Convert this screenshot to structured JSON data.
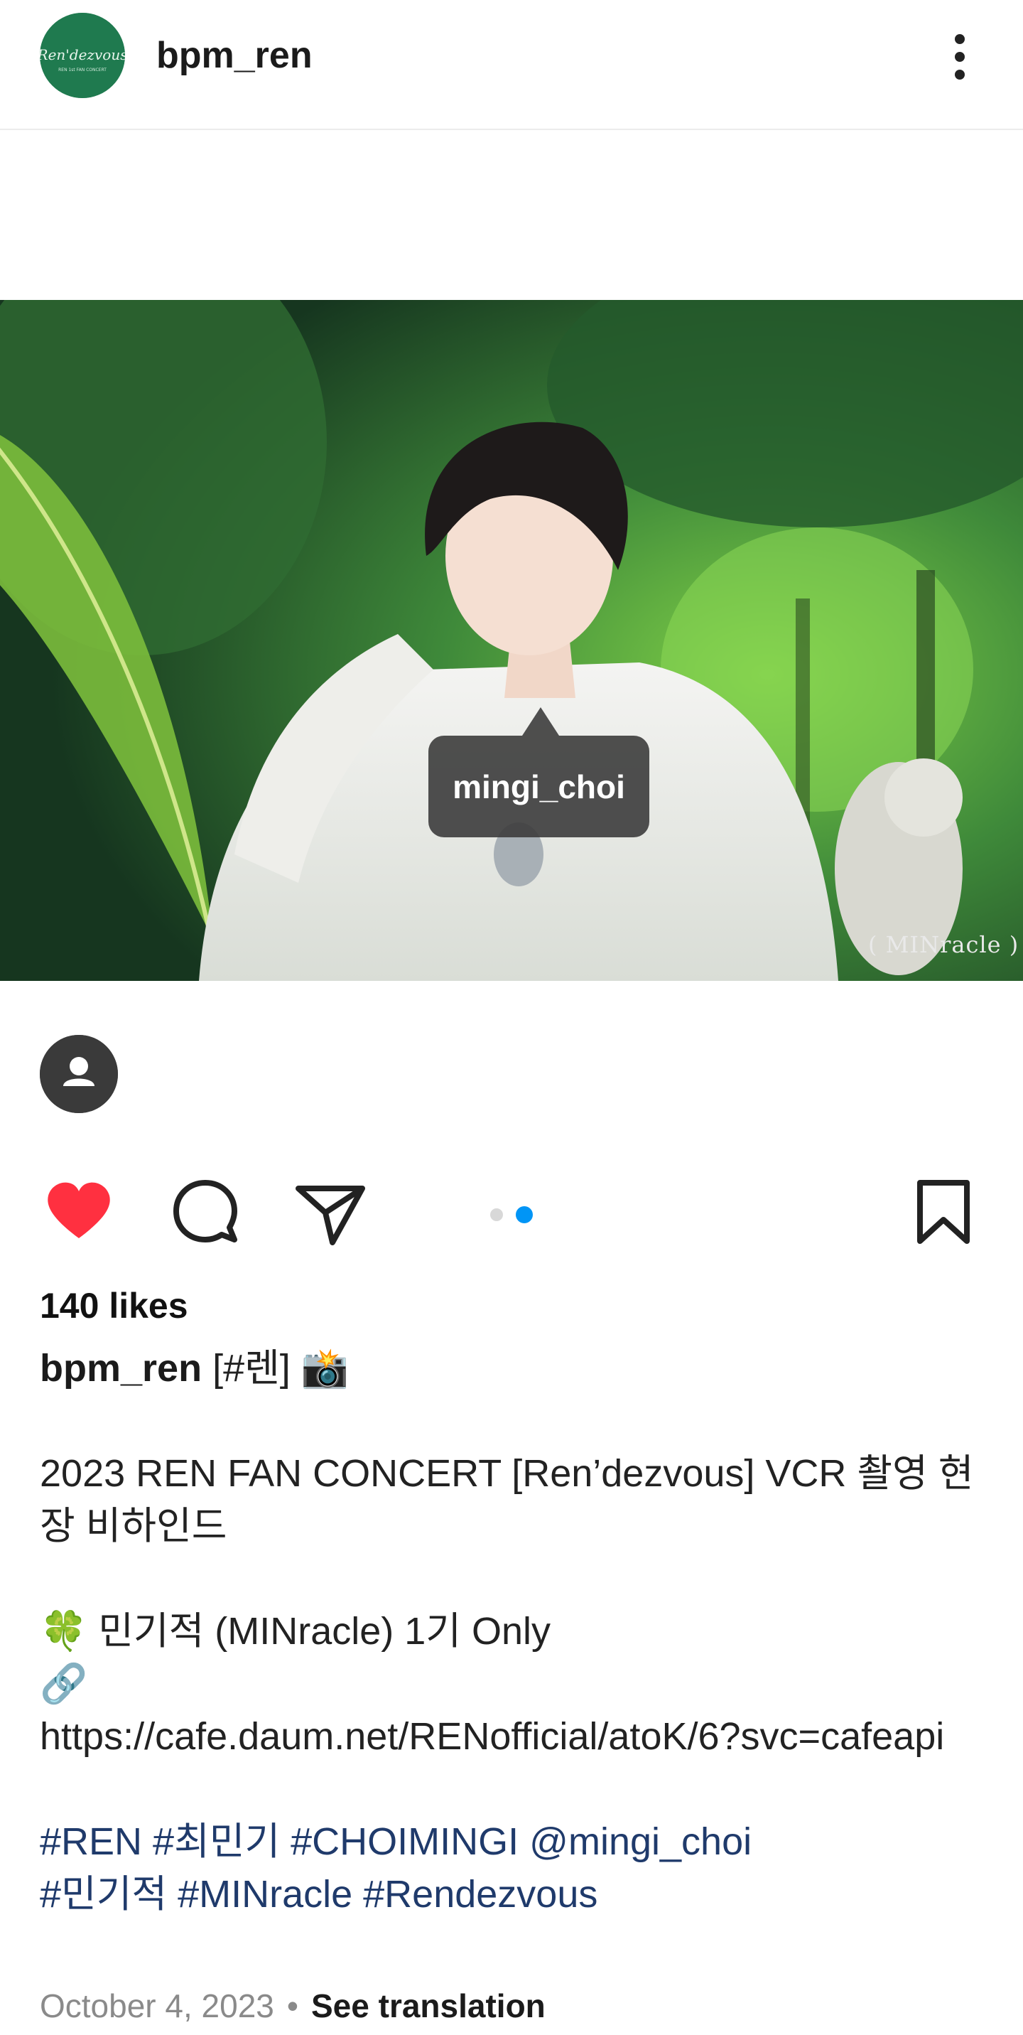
{
  "header": {
    "username": "bpm_ren",
    "avatar_text": "Ren'dezvous",
    "more_icon": "more-vertical-icon"
  },
  "photo": {
    "tag_label": "mingi_choi",
    "watermark": "( MINracle )",
    "alt": "Photo of a person in a white shirt in a green garden"
  },
  "actions": {
    "like_icon": "heart-filled-icon",
    "comment_icon": "comment-icon",
    "share_icon": "send-icon",
    "save_icon": "bookmark-icon",
    "carousel_total": 2,
    "carousel_active": 2
  },
  "post": {
    "likes": "140 likes",
    "owner": "bpm_ren",
    "caption_first": " [#렌] 📸",
    "caption_body": "2023 REN FAN CONCERT [Ren’dezvous] VCR 촬영 현장 비하인드\n\n🍀 민기적 (MINracle) 1기 Only\n🔗\nhttps://cafe.daum.net/RENofficial/atoK/6?svc=cafeapi\n\n",
    "tags_line1": "#REN #최민기 #CHOIMINGI @mingi_choi",
    "tags_line2": "#민기적 #MINracle #Rendezvous",
    "date": "October 4, 2023",
    "separator": "•",
    "see_translation": "See translation"
  },
  "colors": {
    "heart": "#ff3040",
    "link_blue": "#1f3a6b",
    "active_dot": "#0095f6"
  }
}
